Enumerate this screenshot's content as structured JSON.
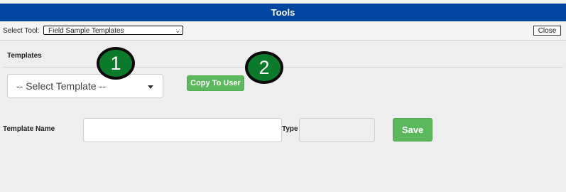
{
  "window": {
    "title": "Tools"
  },
  "toolbar": {
    "select_tool_label": "Select Tool:",
    "selected_tool": "Field Sample Templates",
    "close_label": "Close"
  },
  "templates": {
    "section_label": "Templates",
    "select_value": "-- Select Template --",
    "copy_button": "Copy To User"
  },
  "form": {
    "template_name_label": "Template Name",
    "template_name_value": "",
    "type_label": "Type",
    "type_value": "",
    "save_button": "Save"
  },
  "markers": [
    "1",
    "2"
  ],
  "colors": {
    "titlebar": "#0046a0",
    "button_green": "#5cb85c",
    "marker_green": "#0c7a2b"
  }
}
